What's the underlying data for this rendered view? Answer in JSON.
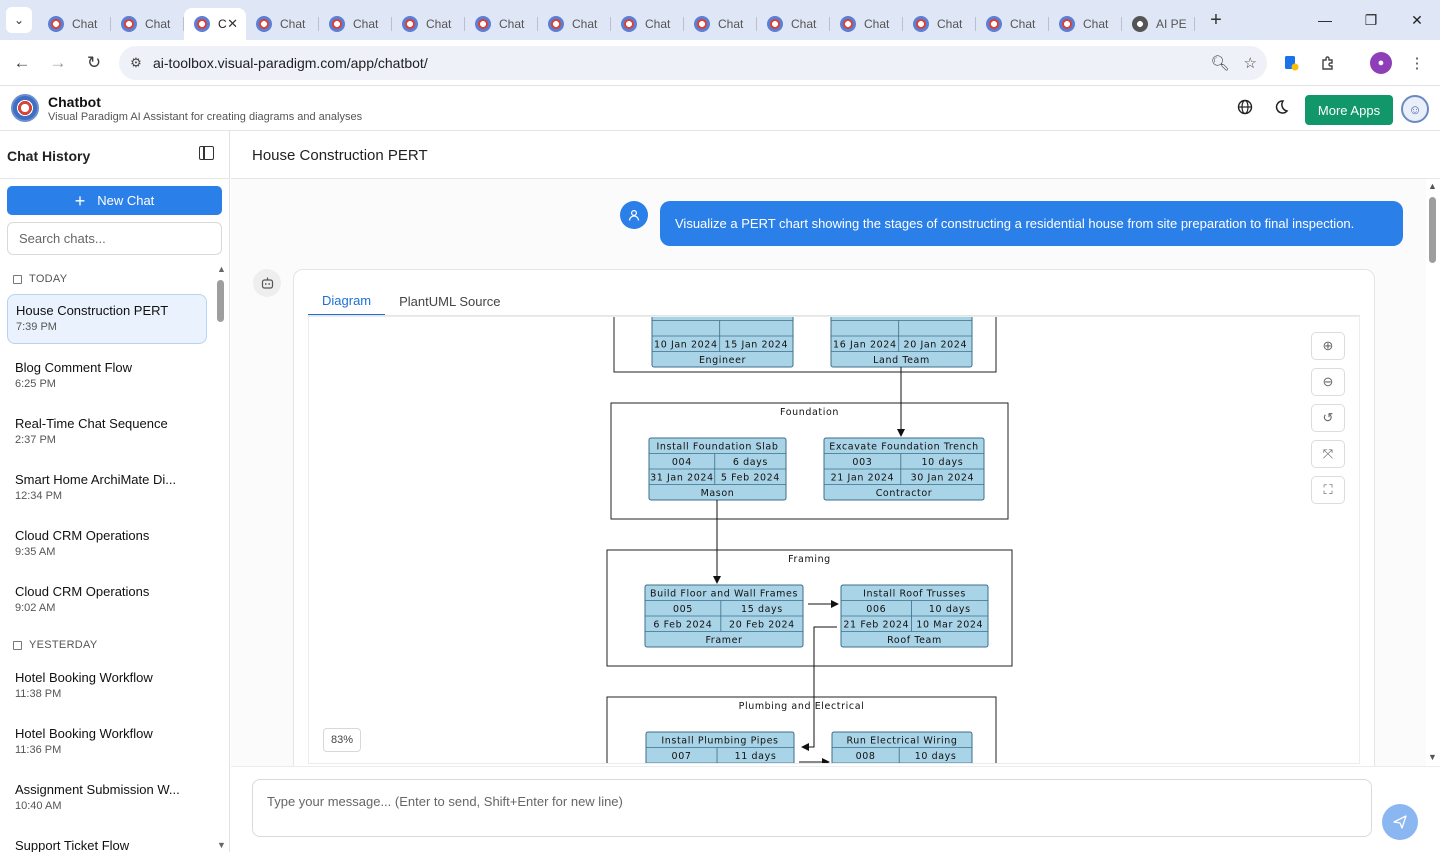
{
  "browser": {
    "tabs": [
      {
        "label": "Chat",
        "icon": "vp-favicon"
      },
      {
        "label": "Chat",
        "icon": "vp-favicon"
      },
      {
        "label": "C",
        "icon": "vp-favicon",
        "active": true
      },
      {
        "label": "Chat",
        "icon": "vp-favicon"
      },
      {
        "label": "Chat",
        "icon": "vp-favicon"
      },
      {
        "label": "Chat",
        "icon": "vp-favicon"
      },
      {
        "label": "Chat",
        "icon": "vp-favicon"
      },
      {
        "label": "Chat",
        "icon": "vp-favicon"
      },
      {
        "label": "Chat",
        "icon": "vp-favicon"
      },
      {
        "label": "Chat",
        "icon": "vp-favicon"
      },
      {
        "label": "Chat",
        "icon": "vp-favicon"
      },
      {
        "label": "Chat",
        "icon": "vp-favicon"
      },
      {
        "label": "Chat",
        "icon": "vp-favicon"
      },
      {
        "label": "Chat",
        "icon": "vp-favicon"
      },
      {
        "label": "Chat",
        "icon": "vp-favicon"
      },
      {
        "label": "AI PE",
        "icon": "openai-favicon"
      }
    ],
    "url": "ai-toolbox.visual-paradigm.com/app/chatbot/"
  },
  "app": {
    "title": "Chatbot",
    "subtitle": "Visual Paradigm AI Assistant for creating diagrams and analyses",
    "more_apps": "More Apps"
  },
  "sidebar": {
    "title": "Chat History",
    "new_chat": "New Chat",
    "search_placeholder": "Search chats...",
    "groups": [
      {
        "label": "TODAY",
        "items": [
          {
            "title": "House Construction PERT",
            "time": "7:39 PM",
            "active": true
          },
          {
            "title": "Blog Comment Flow",
            "time": "6:25 PM"
          },
          {
            "title": "Real-Time Chat Sequence",
            "time": "2:37 PM"
          },
          {
            "title": "Smart Home ArchiMate Di...",
            "time": "12:34 PM"
          },
          {
            "title": "Cloud CRM Operations",
            "time": "9:35 AM"
          },
          {
            "title": "Cloud CRM Operations",
            "time": "9:02 AM"
          }
        ]
      },
      {
        "label": "YESTERDAY",
        "items": [
          {
            "title": "Hotel Booking Workflow",
            "time": "11:38 PM"
          },
          {
            "title": "Hotel Booking Workflow",
            "time": "11:36 PM"
          },
          {
            "title": "Assignment Submission W...",
            "time": "10:40 AM"
          },
          {
            "title": "Support Ticket Flow",
            "time": ""
          }
        ]
      }
    ]
  },
  "main": {
    "title": "House Construction PERT",
    "user_message": "Visualize a PERT chart showing the stages of constructing a residential house from site preparation to final inspection.",
    "tabs": [
      "Diagram",
      "PlantUML Source"
    ],
    "zoom": "83%",
    "composer_placeholder": "Type your message... (Enter to send, Shift+Enter for new line)"
  },
  "diagram": {
    "groups": [
      {
        "name": "Foundation"
      },
      {
        "name": "Framing"
      },
      {
        "name": "Plumbing and Electrical"
      }
    ],
    "tasks": [
      {
        "id": "t-top-left",
        "name": "",
        "code": "",
        "duration": "",
        "start": "10 Jan 2024",
        "end": "15 Jan 2024",
        "owner": "Engineer"
      },
      {
        "id": "t-top-right",
        "name": "",
        "code": "",
        "duration": "",
        "start": "16 Jan 2024",
        "end": "20 Jan 2024",
        "owner": "Land Team"
      },
      {
        "id": "t004",
        "name": "Install Foundation Slab",
        "code": "004",
        "duration": "6 days",
        "start": "31 Jan 2024",
        "end": "5 Feb 2024",
        "owner": "Mason"
      },
      {
        "id": "t003",
        "name": "Excavate Foundation Trench",
        "code": "003",
        "duration": "10 days",
        "start": "21 Jan 2024",
        "end": "30 Jan 2024",
        "owner": "Contractor"
      },
      {
        "id": "t005",
        "name": "Build Floor and Wall Frames",
        "code": "005",
        "duration": "15 days",
        "start": "6 Feb 2024",
        "end": "20 Feb 2024",
        "owner": "Framer"
      },
      {
        "id": "t006",
        "name": "Install Roof Trusses",
        "code": "006",
        "duration": "10 days",
        "start": "21 Feb 2024",
        "end": "10 Mar 2024",
        "owner": "Roof Team"
      },
      {
        "id": "t007",
        "name": "Install Plumbing Pipes",
        "code": "007",
        "duration": "11 days",
        "start": "",
        "end": "",
        "owner": ""
      },
      {
        "id": "t008",
        "name": "Run Electrical Wiring",
        "code": "008",
        "duration": "10 days",
        "start": "",
        "end": "",
        "owner": ""
      }
    ]
  }
}
